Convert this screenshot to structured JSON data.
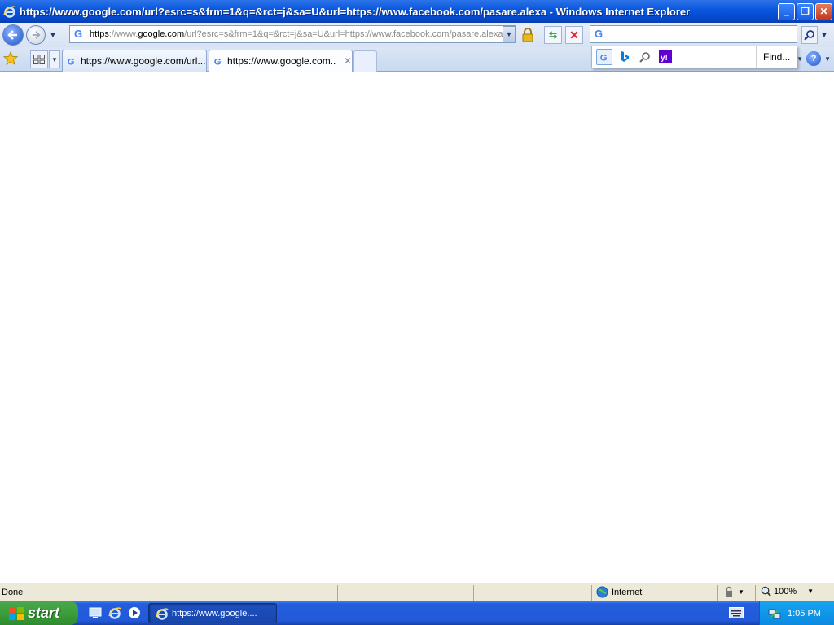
{
  "window": {
    "title": "https://www.google.com/url?esrc=s&frm=1&q=&rct=j&sa=U&url=https://www.facebook.com/pasare.alexa - Windows Internet Explorer"
  },
  "address_bar": {
    "url_scheme": "https",
    "url_prefix": "://www.",
    "url_domain": "google.com",
    "url_rest": "/url?esrc=s&frm=1&q=&rct=j&sa=U&url=https://www.facebook.com/pasare.alexa"
  },
  "search_box": {
    "value": ""
  },
  "search_popup": {
    "providers": [
      "google-icon",
      "bing-icon",
      "search-icon",
      "yahoo-icon"
    ],
    "find_label": "Find..."
  },
  "tabs": [
    {
      "label": "https://www.google.com/url...",
      "active": false
    },
    {
      "label": "https://www.google.com...",
      "active": true
    }
  ],
  "status_bar": {
    "status": "Done",
    "zone": "Internet",
    "zoom": "100%"
  },
  "taskbar": {
    "start_label": "start",
    "task_label": "https://www.google....",
    "clock": "1:05 PM"
  },
  "colors": {
    "titlebar": "#0a58e0",
    "taskbar": "#245edc",
    "start": "#3c9e3c",
    "tray": "#0c8ae0"
  }
}
